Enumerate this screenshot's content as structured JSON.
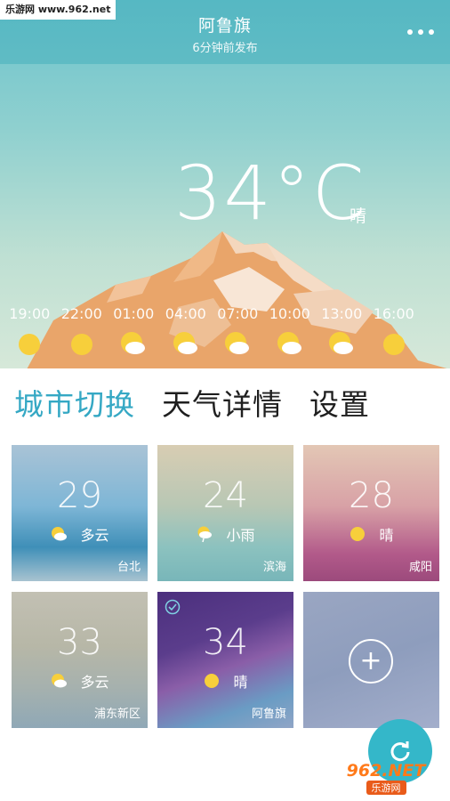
{
  "watermark": {
    "site": "乐游网 www.962.net",
    "logo": "962.NET",
    "logo_sub": "乐游网"
  },
  "header": {
    "city": "阿鲁旗",
    "updated": "6分钟前发布"
  },
  "current": {
    "temperature": "34°C",
    "condition": "晴"
  },
  "hourly": [
    {
      "time": "19:00",
      "icon": "sun-icon"
    },
    {
      "time": "22:00",
      "icon": "sun-icon"
    },
    {
      "time": "01:00",
      "icon": "partly-cloudy-icon"
    },
    {
      "time": "04:00",
      "icon": "partly-cloudy-icon"
    },
    {
      "time": "07:00",
      "icon": "partly-cloudy-icon"
    },
    {
      "time": "10:00",
      "icon": "partly-cloudy-icon"
    },
    {
      "time": "13:00",
      "icon": "partly-cloudy-icon"
    },
    {
      "time": "16:00",
      "icon": "sun-icon"
    }
  ],
  "tabs": [
    {
      "label": "城市切换",
      "active": true
    },
    {
      "label": "天气详情",
      "active": false
    },
    {
      "label": "设置",
      "active": false
    }
  ],
  "cities": [
    {
      "temp": "29",
      "condition": "多云",
      "name": "台北",
      "icon": "partly-cloudy-icon"
    },
    {
      "temp": "24",
      "condition": "小雨",
      "name": "滨海",
      "icon": "light-rain-icon"
    },
    {
      "temp": "28",
      "condition": "晴",
      "name": "咸阳",
      "icon": "sun-icon"
    },
    {
      "temp": "33",
      "condition": "多云",
      "name": "浦东新区",
      "icon": "partly-cloudy-icon"
    },
    {
      "temp": "34",
      "condition": "晴",
      "name": "阿鲁旗",
      "icon": "sun-icon",
      "selected": true
    }
  ],
  "add_city": {
    "symbol": "+"
  },
  "colors": {
    "accent": "#35a8c4",
    "fab": "#34b7c9",
    "sun": "#f7cf3b"
  }
}
